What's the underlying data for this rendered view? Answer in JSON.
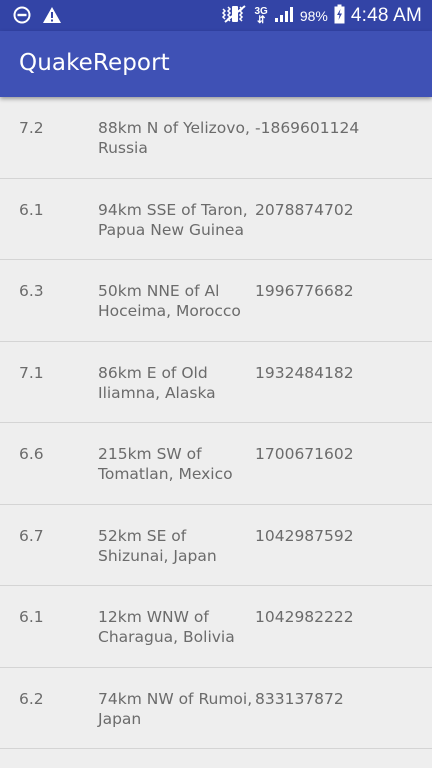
{
  "status_bar": {
    "network": "3G",
    "battery": "98%",
    "time": "4:48 AM",
    "icons": [
      "do-not-disturb-icon",
      "warning-icon",
      "vibrate-icon",
      "signal-icon",
      "battery-charging-icon"
    ]
  },
  "app_bar": {
    "title": "QuakeReport",
    "color": "#3f51b5"
  },
  "earthquakes": [
    {
      "magnitude": "7.2",
      "location": "88km N of Yelizovo, Russia",
      "time": "-1869601124"
    },
    {
      "magnitude": "6.1",
      "location": "94km SSE of Taron, Papua New Guinea",
      "time": "2078874702"
    },
    {
      "magnitude": "6.3",
      "location": "50km NNE of Al Hoceima, Morocco",
      "time": "1996776682"
    },
    {
      "magnitude": "7.1",
      "location": "86km E of Old Iliamna, Alaska",
      "time": "1932484182"
    },
    {
      "magnitude": "6.6",
      "location": "215km SW of Tomatlan, Mexico",
      "time": "1700671602"
    },
    {
      "magnitude": "6.7",
      "location": "52km SE of Shizunai, Japan",
      "time": "1042987592"
    },
    {
      "magnitude": "6.1",
      "location": "12km WNW of Charagua, Bolivia",
      "time": "1042982222"
    },
    {
      "magnitude": "6.2",
      "location": "74km NW of Rumoi, Japan",
      "time": "833137872"
    }
  ]
}
